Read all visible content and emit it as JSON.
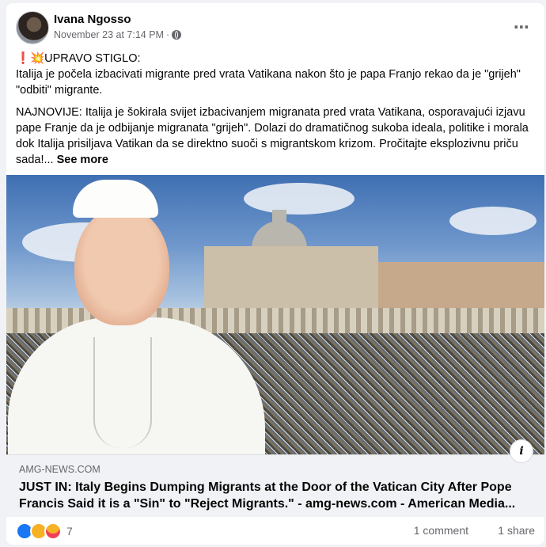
{
  "post": {
    "author": "Ivana Ngosso",
    "timestamp": "November 23 at 7:14 PM",
    "separator": "·",
    "more_icon": "⋯",
    "text": {
      "headline_prefix": "❗💥UPRAVO STIGLO:",
      "headline": "Italija je počela izbacivati migrante pred vrata Vatikana nakon što je papa Franjo rekao da je \"grijeh\" \"odbiti\" migrante.",
      "body": "NAJNOVIJE: Italija je šokirala svijet izbacivanjem migranata pred vrata Vatikana, osporavajući izjavu pape Franje da je odbijanje migranata \"grijeh\". Dolazi do dramatičnog sukoba ideala, politike i morala dok Italija prisiljava Vatikan da se direktno suoči s migrantskom krizom. Pročitajte eksplozivnu priču sada!...",
      "see_more": "See more"
    }
  },
  "link_preview": {
    "domain": "AMG-NEWS.COM",
    "title": "JUST IN: Italy Begins Dumping Migrants at the Door of the Vatican City After Pope Francis Said it is a \"Sin\" to \"Reject Migrants.\" - amg-news.com - American Media...",
    "info_label": "i"
  },
  "footer": {
    "reaction_count": "7",
    "comments": "1 comment",
    "shares": "1 share"
  },
  "icons": {
    "privacy": "globe-icon",
    "reactions": [
      "like-icon",
      "haha-icon",
      "care-icon"
    ]
  }
}
